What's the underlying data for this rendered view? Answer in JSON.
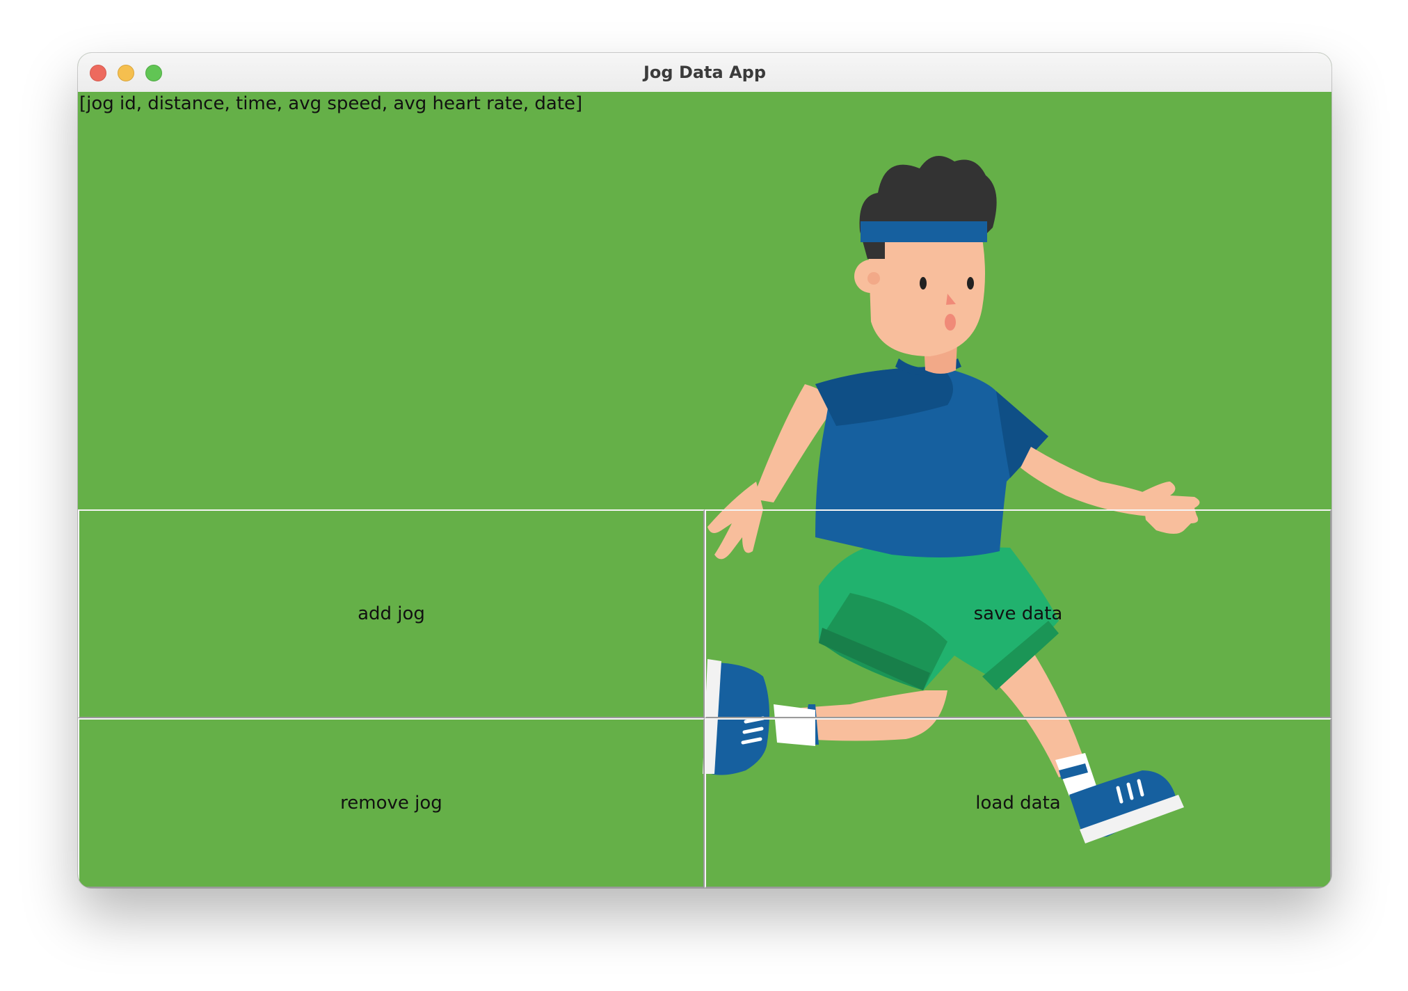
{
  "window": {
    "title": "Jog Data App"
  },
  "list": {
    "header": "[jog id, distance, time, avg speed, avg heart rate, date]"
  },
  "buttons": {
    "add_jog": "add jog",
    "save_data": "save data",
    "remove_jog": "remove jog",
    "load_data": "load data"
  },
  "colors": {
    "background": "#65b048",
    "shirt": "#16609f",
    "shorts": "#21b26e",
    "skin": "#f8be9c",
    "hair": "#333333"
  },
  "icons": {
    "close": "close-icon",
    "minimize": "minimize-icon",
    "maximize": "maximize-icon",
    "illustration": "jogger-illustration"
  }
}
